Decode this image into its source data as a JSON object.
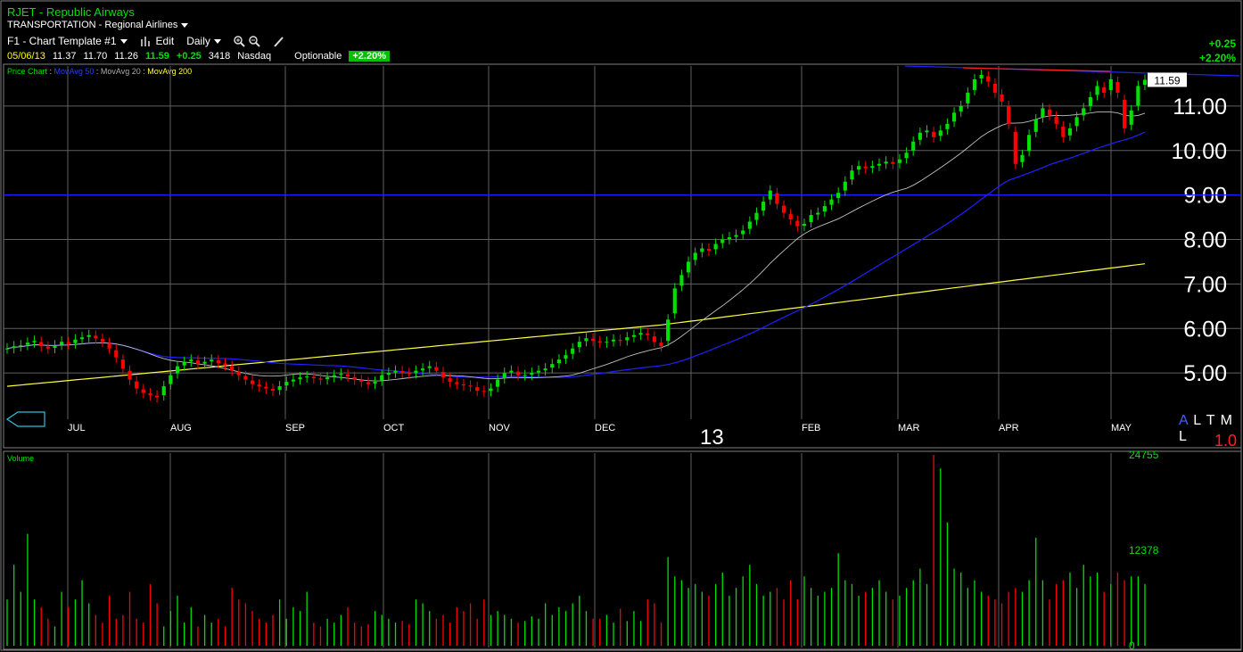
{
  "header": {
    "symbol": "RJET",
    "separator": " - ",
    "company": "Republic Airways",
    "sector": "TRANSPORTATION",
    "industry": "Regional Airlines",
    "template": "F1 - Chart Template #1",
    "edit_label": "Edit",
    "period": "Daily",
    "date": "05/06/13",
    "open": "11.37",
    "high": "11.70",
    "low": "11.26",
    "close": "11.59",
    "change": "+0.25",
    "volume": "3418",
    "exchange": "Nasdaq",
    "optionable": "Optionable",
    "pct_badge": "+2.20%",
    "right_change": "+0.25",
    "right_pct": "+2.20%"
  },
  "legend": {
    "price": "Price Chart",
    "ma50": "MovAvg 50",
    "ma20": "MovAvg 20",
    "ma200": "MovAvg 200"
  },
  "altml": {
    "a": "A",
    "rest": "L T M L"
  },
  "ratio": "1.0",
  "colors": {
    "up": "#00e000",
    "down": "#ff0000",
    "ma50": "#2020ff",
    "ma20": "#c0c0c0",
    "ma200": "#ffff40",
    "grid": "#606060",
    "hline": "#2020ff",
    "trend": "#ff2020"
  },
  "icons": [
    "bar-chart-icon",
    "zoom-in-icon",
    "zoom-out-icon",
    "pencil-icon",
    "scroll-left-icon"
  ],
  "chart_data": [
    {
      "type": "candlestick",
      "title": "RJET - Republic Airways",
      "month_labels": [
        "JUL",
        "AUG",
        "SEP",
        "OCT",
        "NOV",
        "DEC",
        "13",
        "FEB",
        "MAR",
        "APR",
        "MAY"
      ],
      "y_ticks": [
        5,
        6,
        7,
        8,
        9,
        10,
        11
      ],
      "ylim": [
        4.0,
        11.9
      ],
      "last_price_label": "11.59",
      "horizontal_line": 9.0,
      "closes": [
        5.55,
        5.6,
        5.62,
        5.68,
        5.72,
        5.6,
        5.55,
        5.62,
        5.7,
        5.65,
        5.75,
        5.8,
        5.85,
        5.78,
        5.7,
        5.55,
        5.35,
        5.1,
        4.85,
        4.65,
        4.55,
        4.5,
        4.45,
        4.7,
        4.95,
        5.15,
        5.25,
        5.3,
        5.2,
        5.25,
        5.3,
        5.22,
        5.18,
        5.05,
        4.95,
        4.85,
        4.75,
        4.7,
        4.65,
        4.6,
        4.7,
        4.8,
        4.85,
        4.9,
        4.92,
        4.88,
        4.85,
        4.9,
        4.95,
        4.98,
        4.92,
        4.85,
        4.8,
        4.75,
        4.8,
        4.95,
        5.0,
        5.05,
        5.0,
        4.98,
        5.05,
        5.1,
        5.15,
        5.05,
        4.9,
        4.8,
        4.75,
        4.72,
        4.7,
        4.6,
        4.58,
        4.65,
        4.85,
        5.0,
        5.05,
        4.95,
        4.95,
        5.0,
        5.05,
        5.1,
        5.2,
        5.3,
        5.4,
        5.55,
        5.7,
        5.78,
        5.72,
        5.68,
        5.7,
        5.75,
        5.72,
        5.8,
        5.85,
        5.9,
        5.85,
        5.7,
        5.6,
        6.2,
        6.9,
        7.2,
        7.5,
        7.7,
        7.8,
        7.75,
        7.9,
        8.0,
        8.05,
        8.1,
        8.2,
        8.4,
        8.6,
        8.85,
        9.1,
        8.8,
        8.6,
        8.45,
        8.3,
        8.35,
        8.55,
        8.6,
        8.75,
        8.9,
        9.05,
        9.3,
        9.55,
        9.65,
        9.6,
        9.65,
        9.7,
        9.75,
        9.7,
        9.8,
        9.95,
        10.2,
        10.4,
        10.45,
        10.3,
        10.45,
        10.6,
        10.85,
        11.0,
        11.3,
        11.6,
        11.7,
        11.55,
        11.3,
        11.1,
        10.6,
        9.7,
        9.9,
        10.35,
        10.7,
        10.95,
        10.8,
        10.6,
        10.3,
        10.5,
        10.75,
        10.95,
        11.2,
        11.45,
        11.3,
        11.6,
        11.3,
        10.5,
        10.9,
        11.45,
        11.59
      ],
      "volume": {
        "ticks": [
          "24755",
          "12378",
          "0"
        ],
        "ylim": [
          0,
          24755
        ],
        "values": [
          6000,
          10500,
          7000,
          14500,
          6000,
          5000,
          3500,
          2500,
          7000,
          5000,
          6000,
          8500,
          5500,
          4000,
          3000,
          6500,
          3500,
          4000,
          7000,
          3500,
          3000,
          8000,
          5500,
          2500,
          4500,
          6500,
          3000,
          5000,
          2500,
          4000,
          3000,
          3500,
          2500,
          7500,
          6000,
          5500,
          4500,
          3500,
          3000,
          4000,
          6000,
          3500,
          5000,
          4500,
          7000,
          3000,
          2500,
          3500,
          3000,
          4000,
          5000,
          3000,
          2500,
          2800,
          4500,
          4000,
          3500,
          3000,
          3200,
          2800,
          6000,
          5500,
          4500,
          3500,
          4000,
          3000,
          5000,
          4500,
          5500,
          3500,
          6000,
          4000,
          4500,
          4000,
          3500,
          3000,
          3200,
          3800,
          3500,
          5500,
          4000,
          5000,
          4500,
          5500,
          6500,
          4500,
          3500,
          3500,
          4000,
          3000,
          4800,
          3200,
          4500,
          3200,
          6000,
          5500,
          3000,
          11500,
          9000,
          8500,
          7500,
          8000,
          7000,
          6500,
          8000,
          9500,
          6500,
          7500,
          9000,
          10500,
          8000,
          6500,
          7000,
          7500,
          6000,
          8500,
          6000,
          9000,
          7500,
          6500,
          7000,
          7500,
          12000,
          8500,
          8000,
          6500,
          7000,
          7500,
          8500,
          7000,
          6000,
          6500,
          7500,
          8500,
          10000,
          8000,
          24755,
          23000,
          16000,
          10000,
          9500,
          7500,
          8500,
          7000,
          6500,
          6000,
          5500,
          7000,
          7500,
          7000,
          8500,
          14000,
          8500,
          6000,
          8000,
          8500,
          9500,
          7500,
          10500,
          9000,
          9500,
          7000,
          8000,
          9500,
          8500,
          9000,
          9000,
          8000,
          3500
        ]
      }
    }
  ]
}
